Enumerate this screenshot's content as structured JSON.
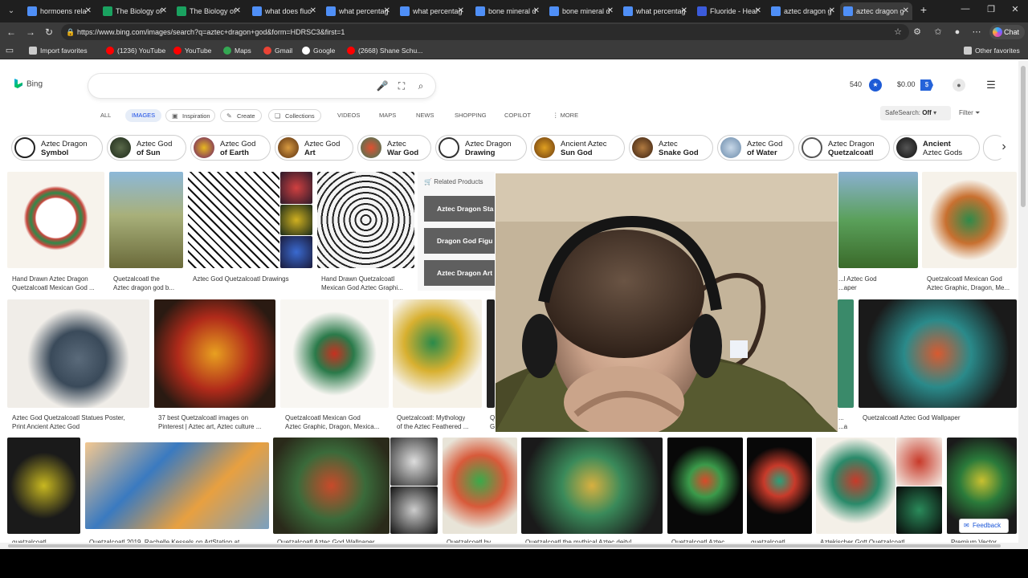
{
  "browser": {
    "tabs": [
      {
        "title": "hormoens rela",
        "favicon_color": "#4f8ff7",
        "active": false
      },
      {
        "title": "The Biology of",
        "favicon_color": "#1aa260",
        "active": false
      },
      {
        "title": "The Biology of",
        "favicon_color": "#1aa260",
        "active": false
      },
      {
        "title": "what does fluo",
        "favicon_color": "#4f8ff7",
        "active": false
      },
      {
        "title": "what percentag",
        "favicon_color": "#4f8ff7",
        "active": false
      },
      {
        "title": "what percentag",
        "favicon_color": "#4f8ff7",
        "active": false
      },
      {
        "title": "bone mineral d",
        "favicon_color": "#4f8ff7",
        "active": false
      },
      {
        "title": "bone mineral d",
        "favicon_color": "#4f8ff7",
        "active": false
      },
      {
        "title": "what percentag",
        "favicon_color": "#4f8ff7",
        "active": false
      },
      {
        "title": "Fluoride - Heal",
        "favicon_color": "#3b5bdb",
        "active": false
      },
      {
        "title": "aztec dragon g",
        "favicon_color": "#4f8ff7",
        "active": false
      },
      {
        "title": "aztec dragon g",
        "favicon_color": "#4f8ff7",
        "active": true
      }
    ],
    "url": "https://www.bing.com/images/search?q=aztec+dragon+god&form=HDRSC3&first=1",
    "chat_label": "Chat",
    "favorites": [
      {
        "label": "Import favorites",
        "icon": "import-icon",
        "color": "#cccccc"
      },
      {
        "label": "(1236) YouTube",
        "icon": "youtube-icon",
        "color": "#ff0000"
      },
      {
        "label": "YouTube",
        "icon": "youtube-icon",
        "color": "#ff0000"
      },
      {
        "label": "Maps",
        "icon": "maps-icon",
        "color": "#34a853"
      },
      {
        "label": "Gmail",
        "icon": "gmail-icon",
        "color": "#ea4335"
      },
      {
        "label": "Google",
        "icon": "google-icon",
        "color": "#ffffff"
      },
      {
        "label": "(2668) Shane Schu...",
        "icon": "youtube-icon",
        "color": "#ff0000"
      }
    ],
    "other_favorites": "Other favorites"
  },
  "bing": {
    "logo_text": "Bing",
    "search_value": "",
    "rewards_points": "540",
    "money": "$0.00",
    "scopes": [
      "ALL",
      "IMAGES",
      "Inspiration",
      "Create",
      "Collections",
      "VIDEOS",
      "MAPS",
      "NEWS",
      "SHOPPING",
      "COPILOT",
      "MORE"
    ],
    "safesearch_label": "SafeSearch:",
    "safesearch_value": "Off",
    "filter_label": "Filter",
    "chips": [
      {
        "line1": "Aztec Dragon",
        "line2": "Symbol"
      },
      {
        "line1": "Aztec God",
        "line2": "of Sun"
      },
      {
        "line1": "Aztec God",
        "line2": "of Earth"
      },
      {
        "line1": "Aztec God",
        "line2": "Art"
      },
      {
        "line1": "Aztec",
        "line2": "War God"
      },
      {
        "line1": "Aztec Dragon",
        "line2": "Drawing"
      },
      {
        "line1": "Ancient Aztec",
        "line2": "Sun God"
      },
      {
        "line1": "Aztec",
        "line2": "Snake God"
      },
      {
        "line1": "Aztec God",
        "line2": "of Water"
      },
      {
        "line1": "Aztec Dragon",
        "line2": "Quetzalcoatl"
      },
      {
        "line1": "Ancient",
        "line2": "Aztec Gods"
      }
    ],
    "related_products": {
      "header": "Related Products",
      "items": [
        "Aztec Dragon Sta",
        "Dragon God Figu",
        "Aztec Dragon Art"
      ]
    },
    "captions": {
      "r1": [
        "Hand Drawn Aztec Dragon",
        "Quetzalcoatl Mexican God ...",
        "Quetzalcoatl the",
        "Aztec dragon god b...",
        "Aztec God Quetzalcoatl Drawings",
        "Hand Drawn Quetzalcoatl",
        "Mexican God Aztec Graphi...",
        "...l Aztec God",
        "...aper",
        "Quetzalcoatl Mexican God",
        "Aztec Graphic, Dragon, Me..."
      ],
      "r2": [
        "Aztec God Quetzalcoatl Statues Poster,",
        "Print Ancient Aztec God",
        "37 best Quetzalcoatl images on",
        "Pinterest | Aztec art, Aztec culture ...",
        "Quetzalcoatl Mexican God",
        "Aztec Graphic, Dragon, Mexica...",
        "Quetzalcoatl: Mythology",
        "of the Aztec Feathered ...",
        "Q",
        "G",
        "...",
        "...a",
        "Quetzalcoatl Aztec God Wallpaper"
      ],
      "r3": [
        "quetzalcoatl",
        "Quetzalcoatl 2019, Rachelle Kessels on ArtStation at...",
        "Quetzalcoatl Aztec God Wallpaper",
        "Quetzalcoatl by ...",
        "Quetzalcoatl the mythical Aztec deity!...",
        "Quetzalcoatl Aztec ...",
        "quetzalcoatl ...",
        "Aztekischer Gott Quetzalcoatl ...",
        "Premium Vector ..."
      ]
    },
    "feedback_label": "Feedback"
  }
}
